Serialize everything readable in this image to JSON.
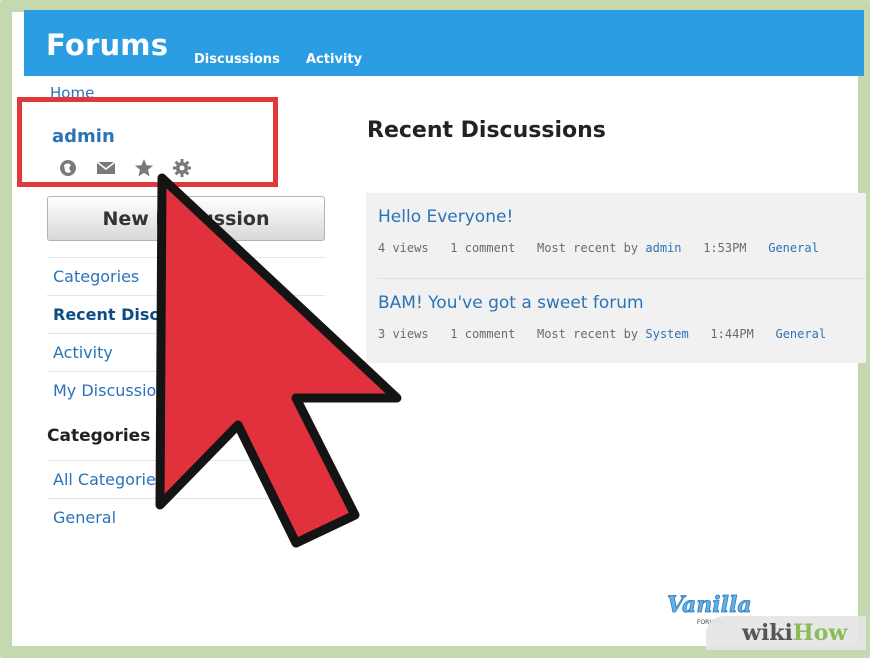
{
  "header": {
    "brand": "Forums",
    "nav": [
      "Discussions",
      "Activity"
    ]
  },
  "breadcrumb": "Home",
  "user": {
    "name": "admin",
    "icons": [
      "globe-icon",
      "mail-icon",
      "star-icon",
      "gear-icon"
    ]
  },
  "new_button": "New Discussion",
  "sidebar": {
    "items": [
      {
        "label": "Categories"
      },
      {
        "label": "Recent Discussions"
      },
      {
        "label": "Activity"
      },
      {
        "label": "My Discussions"
      }
    ],
    "categories_heading": "Categories",
    "categories": [
      {
        "label": "All Categories"
      },
      {
        "label": "General"
      }
    ]
  },
  "main": {
    "title": "Recent Discussions",
    "discussions": [
      {
        "title": "Hello Everyone!",
        "views": "4 views",
        "comments": "1 comment",
        "recent_prefix": "Most recent by",
        "recent_by": "admin",
        "time": "1:53PM",
        "category": "General"
      },
      {
        "title": "BAM! You've got a sweet forum",
        "views": "3 views",
        "comments": "1 comment",
        "recent_prefix": "Most recent by",
        "recent_by": "System",
        "time": "1:44PM",
        "category": "General"
      }
    ]
  },
  "watermark": {
    "wiki": "wiki",
    "how": "How",
    "vanilla": "Vanilla",
    "vanilla_sub": "FORUMS"
  },
  "colors": {
    "header": "#2a9de3",
    "link": "#2b73b7",
    "highlight": "#e0383c",
    "arrow": "#e0313d"
  }
}
